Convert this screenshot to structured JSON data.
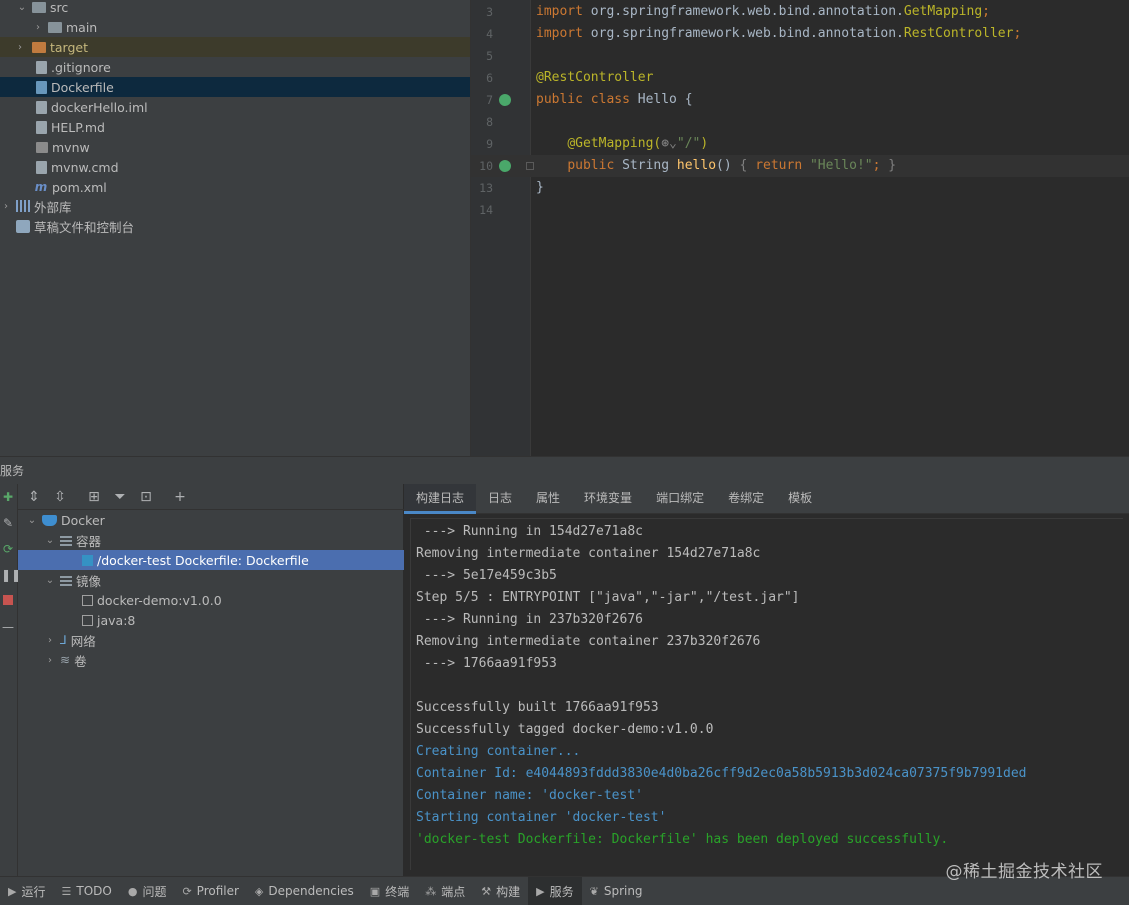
{
  "project_tree": {
    "items": [
      {
        "label": "src",
        "chevron": "v"
      },
      {
        "label": "main",
        "chevron": ">"
      },
      {
        "label": "target",
        "chevron": ">"
      },
      {
        "label": ".gitignore"
      },
      {
        "label": "Dockerfile"
      },
      {
        "label": "dockerHello.iml"
      },
      {
        "label": "HELP.md"
      },
      {
        "label": "mvnw"
      },
      {
        "label": "mvnw.cmd"
      },
      {
        "label": "pom.xml"
      },
      {
        "label": "外部库",
        "chevron": ">"
      },
      {
        "label": "草稿文件和控制台"
      }
    ]
  },
  "editor": {
    "lines": [
      {
        "num": "3",
        "parts": [
          [
            "kw",
            "import "
          ],
          [
            "plain",
            "org.springframework.web.bind.annotation."
          ],
          [
            "ann",
            "GetMapping"
          ],
          [
            "kw",
            ";"
          ]
        ]
      },
      {
        "num": "4",
        "parts": [
          [
            "kw",
            "import "
          ],
          [
            "plain",
            "org.springframework.web.bind.annotation."
          ],
          [
            "ann",
            "RestController"
          ],
          [
            "kw",
            ";"
          ]
        ]
      },
      {
        "num": "5",
        "parts": []
      },
      {
        "num": "6",
        "parts": [
          [
            "ann",
            "@RestController"
          ]
        ]
      },
      {
        "num": "7",
        "parts": [
          [
            "kw",
            "public class "
          ],
          [
            "plain",
            "Hello {"
          ]
        ]
      },
      {
        "num": "8",
        "parts": []
      },
      {
        "num": "9",
        "parts": [
          [
            "plain",
            "    "
          ],
          [
            "ann",
            "@GetMapping("
          ],
          [
            "fg",
            "⊛⌄"
          ],
          [
            "str",
            "\"/\""
          ],
          [
            "ann",
            ")"
          ]
        ]
      },
      {
        "num": "10",
        "parts": [
          [
            "plain",
            "    "
          ],
          [
            "kw",
            "public "
          ],
          [
            "plain",
            "String "
          ],
          [
            "fn",
            "hello"
          ],
          [
            "plain",
            "() "
          ],
          [
            "fg",
            "{ "
          ],
          [
            "kw",
            "return "
          ],
          [
            "str",
            "\"Hello!\""
          ],
          [
            "kw",
            "; "
          ],
          [
            "fg",
            "}"
          ]
        ]
      },
      {
        "num": "13",
        "parts": [
          [
            "plain",
            "}"
          ]
        ]
      },
      {
        "num": "14",
        "parts": []
      }
    ]
  },
  "services": {
    "title": "服务",
    "tree": [
      {
        "label": "Docker"
      },
      {
        "label": "容器"
      },
      {
        "label": "/docker-test Dockerfile: Dockerfile"
      },
      {
        "label": "镜像"
      },
      {
        "label": "docker-demo:v1.0.0"
      },
      {
        "label": "java:8"
      },
      {
        "label": "网络"
      },
      {
        "label": "卷"
      }
    ],
    "tabs": [
      "构建日志",
      "日志",
      "属性",
      "环境变量",
      "端口绑定",
      "卷绑定",
      "模板"
    ],
    "log_lines": [
      {
        "kind": "plain",
        "text": " ---> Running in 154d27e71a8c"
      },
      {
        "kind": "plain",
        "text": "Removing intermediate container 154d27e71a8c"
      },
      {
        "kind": "plain",
        "text": " ---> 5e17e459c3b5"
      },
      {
        "kind": "plain",
        "text": "Step 5/5 : ENTRYPOINT [\"java\",\"-jar\",\"/test.jar\"]"
      },
      {
        "kind": "plain",
        "text": " ---> Running in 237b320f2676"
      },
      {
        "kind": "plain",
        "text": "Removing intermediate container 237b320f2676"
      },
      {
        "kind": "plain",
        "text": " ---> 1766aa91f953"
      },
      {
        "kind": "plain",
        "text": ""
      },
      {
        "kind": "plain",
        "text": "Successfully built 1766aa91f953"
      },
      {
        "kind": "plain",
        "text": "Successfully tagged docker-demo:v1.0.0"
      },
      {
        "kind": "info",
        "text": "Creating container..."
      },
      {
        "kind": "info",
        "text": "Container Id: e4044893fddd3830e4d0ba26cff9d2ec0a58b5913b3d024ca07375f9b7991ded"
      },
      {
        "kind": "info",
        "text": "Container name: 'docker-test'"
      },
      {
        "kind": "info",
        "text": "Starting container 'docker-test'"
      },
      {
        "kind": "ok",
        "text": "'docker-test Dockerfile: Dockerfile' has been deployed successfully."
      }
    ]
  },
  "status_bar": {
    "items": [
      {
        "glyph": "▶",
        "label": "运行"
      },
      {
        "glyph": "☰",
        "label": "TODO"
      },
      {
        "glyph": "●",
        "label": "问题"
      },
      {
        "glyph": "⟳",
        "label": "Profiler"
      },
      {
        "glyph": "◈",
        "label": "Dependencies"
      },
      {
        "glyph": "▣",
        "label": "终端"
      },
      {
        "glyph": "⁂",
        "label": "端点"
      },
      {
        "glyph": "⚒",
        "label": "构建"
      },
      {
        "glyph": "▶",
        "label": "服务"
      },
      {
        "glyph": "❦",
        "label": "Spring"
      }
    ]
  },
  "watermark": "@稀土掘金技术社区"
}
